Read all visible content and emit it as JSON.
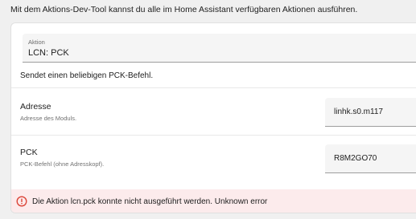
{
  "intro_text": "Mit dem Aktions-Dev-Tool kannst du alle im Home Assistant verfügbaren Aktionen ausführen.",
  "action_field": {
    "label": "Aktion",
    "value": "LCN: PCK"
  },
  "action_description": "Sendet einen beliebigen PCK-Befehl.",
  "fields": [
    {
      "name": "Adresse",
      "help": "Adresse des Moduls.",
      "value": "linhk.s0.m117"
    },
    {
      "name": "PCK",
      "help": "PCK-Befehl (ohne Adresskopf).",
      "value": "R8M2GO70"
    }
  ],
  "error": {
    "message": "Die Aktion lcn.pck konnte nicht ausgeführt werden. Unknown error",
    "color": "#db4437"
  },
  "icons": {
    "error": "alert-circle-icon"
  }
}
